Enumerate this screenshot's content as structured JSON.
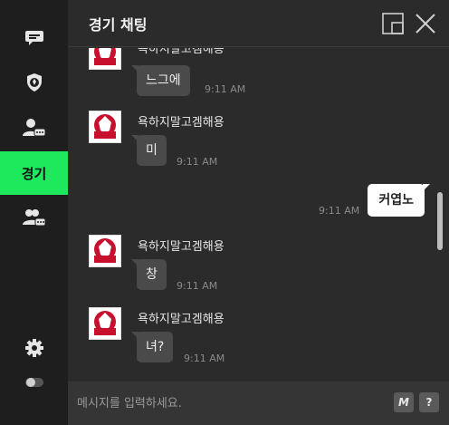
{
  "header": {
    "title": "경기 채팅"
  },
  "sidebar": {
    "items": [
      {
        "icon": "chat-bubble-icon"
      },
      {
        "icon": "team-shield-icon"
      },
      {
        "icon": "user-chat-icon"
      },
      {
        "label": "경기",
        "active": true
      },
      {
        "icon": "group-chat-icon"
      }
    ],
    "bottom": [
      {
        "icon": "gear-icon"
      },
      {
        "icon": "toggle-icon"
      }
    ]
  },
  "messages": [
    {
      "sender": "욕하지말고겜해용",
      "text": "느그에",
      "time": "9:11 AM"
    },
    {
      "sender": "욕하지말고겜해용",
      "text": "미",
      "time": "9:11 AM"
    },
    {
      "mine": true,
      "text": "커엽노",
      "time": "9:11 AM"
    },
    {
      "sender": "욕하지말고겜해용",
      "text": "창",
      "time": "9:11 AM"
    },
    {
      "sender": "욕하지말고겜해용",
      "text": "녀?",
      "time": "9:11 AM"
    }
  ],
  "avatar_text": "LOSC",
  "input": {
    "placeholder": "메시지를 입력하세요.",
    "value": ""
  },
  "buttons": {
    "macro": "M",
    "help": "?"
  },
  "colors": {
    "accent": "#1ee85c",
    "sidebar": "#1e1e1e",
    "background": "#2b2b2b",
    "bubble": "#4a4a4a"
  }
}
